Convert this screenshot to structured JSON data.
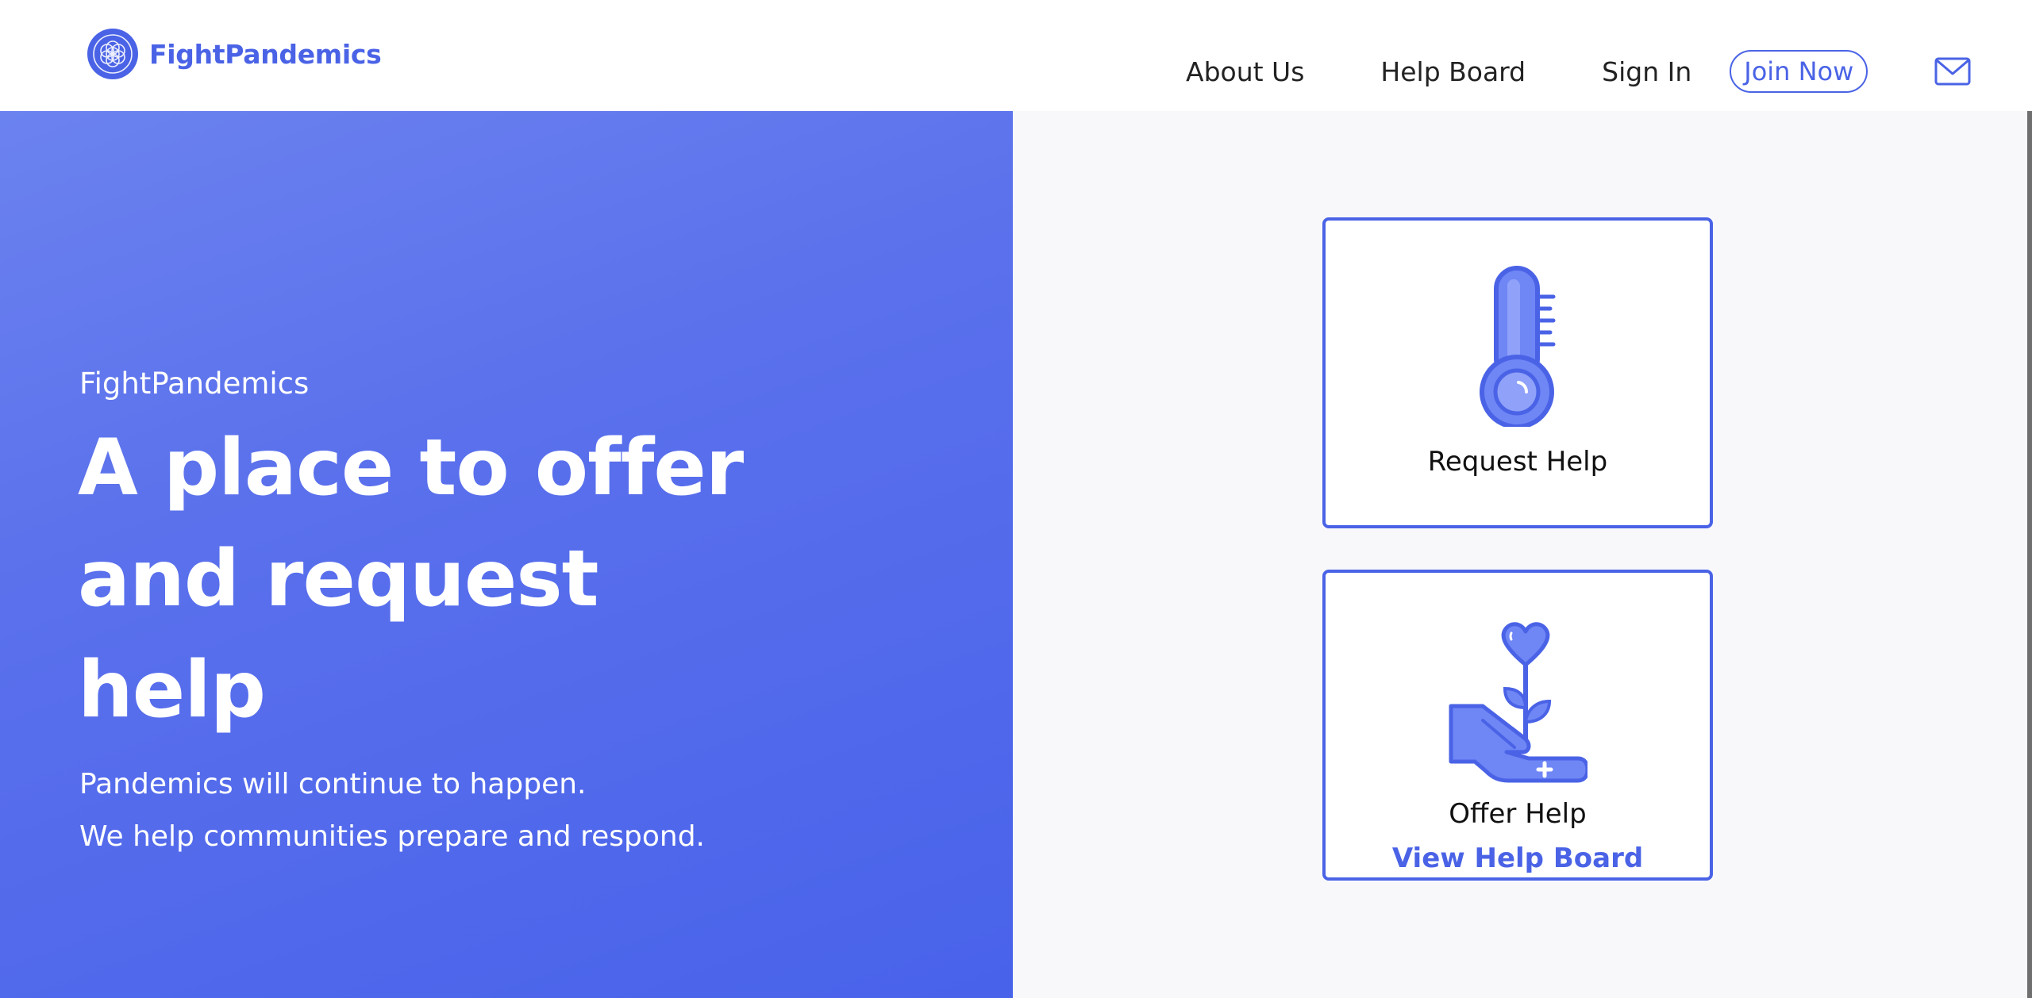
{
  "header": {
    "logo_text": "FightPandemics",
    "nav": {
      "about": "About Us",
      "help_board": "Help Board",
      "sign_in": "Sign In",
      "join_now": "Join Now"
    },
    "icons": [
      "logo-icon",
      "mail-icon"
    ]
  },
  "hero": {
    "brand": "FightPandemics",
    "title": "A place to offer and request help",
    "subtitle_line1": "Pandemics will continue to happen.",
    "subtitle_line2": "We help communities prepare and respond."
  },
  "actions": {
    "request_help": "Request Help",
    "offer_help": "Offer Help",
    "view_help_board": "View Help Board",
    "icons": [
      "thermometer-icon",
      "hand-flower-icon"
    ]
  },
  "colors": {
    "brand": "#4a63e6",
    "hero_gradient_start": "#6b82ef",
    "hero_gradient_end": "#4862ea",
    "panel_background": "#f8f8fb",
    "icon_fill": "#6f86f5"
  }
}
